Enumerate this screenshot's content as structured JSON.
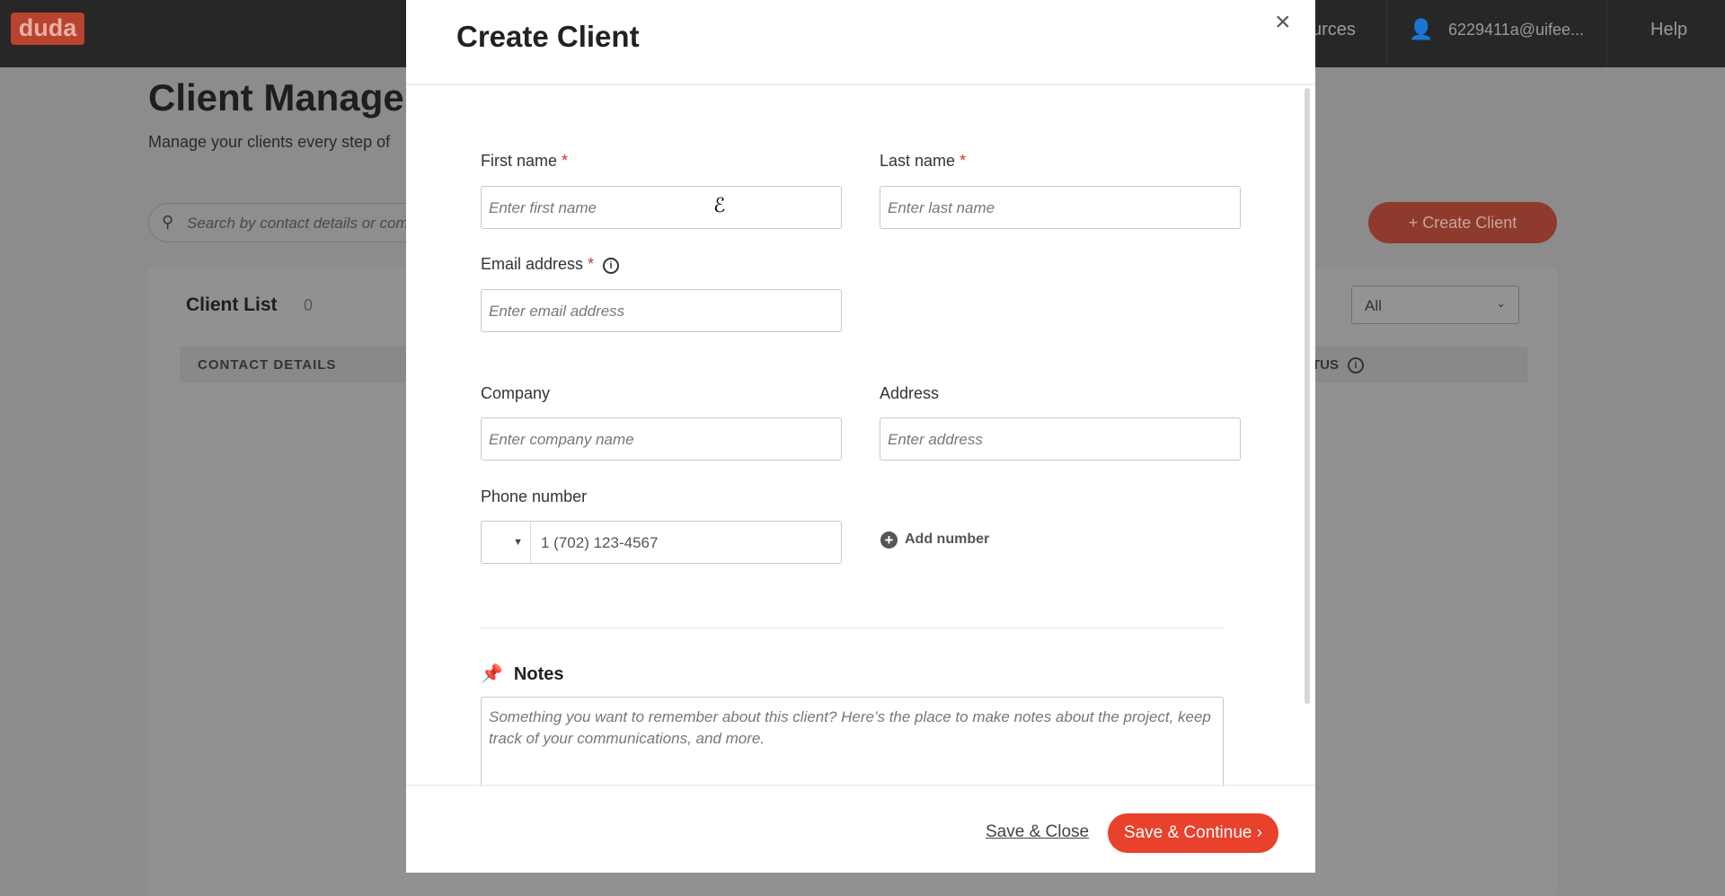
{
  "topbar": {
    "logo": "duda",
    "resources": "urces",
    "user": "6229411a@uifee...",
    "help": "Help"
  },
  "background": {
    "title": "Client Managen",
    "subtitle": "Manage your clients every step of",
    "search_placeholder": "Search by contact details or comp",
    "create_button": "+ Create Client",
    "list_title": "Client List",
    "list_count": "0",
    "filter": "All",
    "col_contact": "CONTACT DETAILS",
    "col_status": "TUS"
  },
  "modal": {
    "title": "Create Client",
    "first_name": {
      "label": "First name",
      "placeholder": "Enter first name"
    },
    "last_name": {
      "label": "Last name",
      "placeholder": "Enter last name"
    },
    "email": {
      "label": "Email address",
      "placeholder": "Enter email address"
    },
    "company": {
      "label": "Company",
      "placeholder": "Enter company name"
    },
    "address": {
      "label": "Address",
      "placeholder": "Enter address"
    },
    "phone": {
      "label": "Phone number",
      "value": "1 (702) 123-4567"
    },
    "add_number": "Add number",
    "notes": {
      "label": "Notes",
      "placeholder": "Something you want to remember about this client? Here’s the place to make notes about the project, keep track of your communications, and more."
    },
    "save_close": "Save & Close",
    "save_continue": "Save & Continue",
    "required_mark": "*"
  },
  "colors": {
    "accent": "#e8412c",
    "required": "#d0323b"
  }
}
